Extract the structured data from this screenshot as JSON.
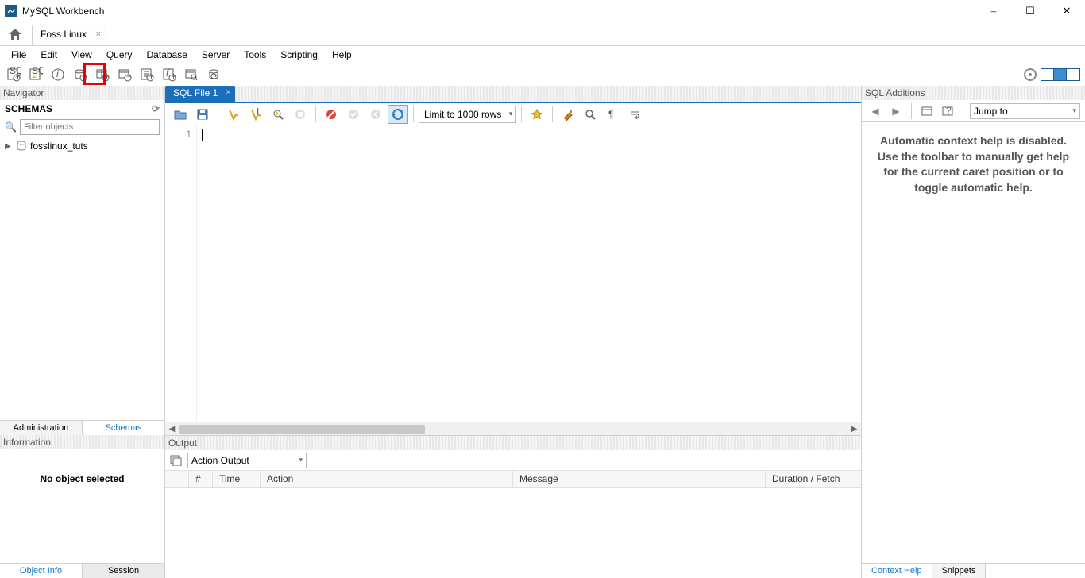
{
  "window": {
    "title": "MySQL Workbench"
  },
  "connection_tab": {
    "label": "Foss Linux"
  },
  "menu": {
    "file": "File",
    "edit": "Edit",
    "view": "View",
    "query": "Query",
    "database": "Database",
    "server": "Server",
    "tools": "Tools",
    "scripting": "Scripting",
    "help": "Help"
  },
  "navigator": {
    "title": "Navigator",
    "schemas_label": "SCHEMAS",
    "filter_placeholder": "Filter objects",
    "schemas": [
      {
        "name": "fosslinux_tuts"
      }
    ],
    "tabs": {
      "admin": "Administration",
      "schemas": "Schemas"
    }
  },
  "information": {
    "title": "Information",
    "body": "No object selected",
    "tabs": {
      "obj": "Object Info",
      "session": "Session"
    }
  },
  "sql_editor": {
    "tab_label": "SQL File 1",
    "limit_label": "Limit to 1000 rows",
    "line_number": "1"
  },
  "output": {
    "title": "Output",
    "selector": "Action Output",
    "columns": {
      "blank": "",
      "hash": "#",
      "time": "Time",
      "action": "Action",
      "message": "Message",
      "duration": "Duration / Fetch"
    }
  },
  "sql_additions": {
    "title": "SQL Additions",
    "jump_label": "Jump to",
    "help_text": "Automatic context help is disabled. Use the toolbar to manually get help for the current caret position or to toggle automatic help.",
    "tabs": {
      "context": "Context Help",
      "snippets": "Snippets"
    }
  }
}
